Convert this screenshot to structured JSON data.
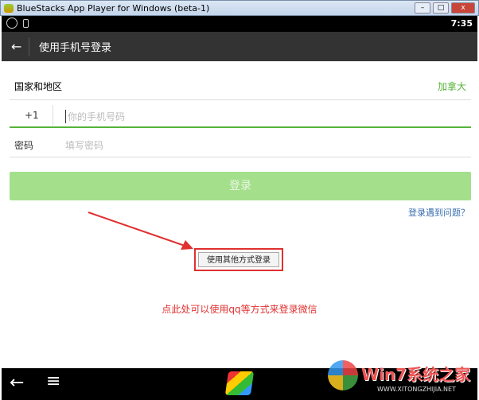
{
  "window": {
    "title": "BlueStacks App Player for Windows (beta-1)",
    "minimize": "–",
    "maximize": "□",
    "close": "x"
  },
  "status": {
    "time": "7:35"
  },
  "header": {
    "title": "使用手机号登录"
  },
  "form": {
    "region_label": "国家和地区",
    "region_value": "加拿大",
    "country_code": "+1",
    "phone_placeholder": "你的手机号码",
    "password_label": "密码",
    "password_placeholder": "填写密码",
    "login_button": "登录",
    "trouble_link": "登录遇到问题？",
    "other_login_button": "使用其他方式登录"
  },
  "annotation": {
    "text": "点此处可以使用qq等方式来登录微信"
  },
  "watermark": {
    "brand": "Win7系统之家",
    "url": "WWW.XITONGZHIJIA.NET"
  },
  "colors": {
    "accent": "#55b33a",
    "button": "#a4df8c",
    "annotation": "#e03030"
  }
}
